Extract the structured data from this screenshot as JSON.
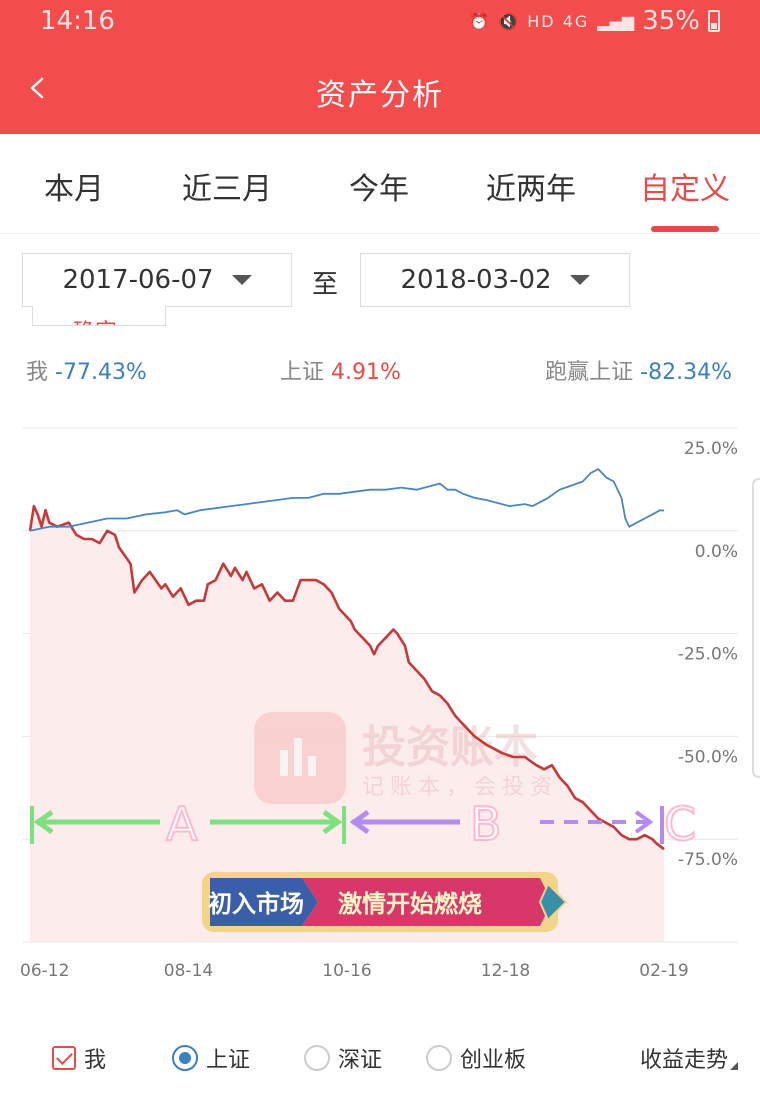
{
  "status_bar": {
    "time": "14:16",
    "icons": "⏰ 🔇 HD 4G",
    "battery": "35%"
  },
  "header": {
    "back_icon": "chevron-left-icon",
    "title": "资产分析"
  },
  "tabs": [
    {
      "label": "本月",
      "active": false
    },
    {
      "label": "近三月",
      "active": false
    },
    {
      "label": "今年",
      "active": false
    },
    {
      "label": "近两年",
      "active": false
    },
    {
      "label": "自定义",
      "active": true
    }
  ],
  "date_range": {
    "start": "2017-06-07",
    "separator": "至",
    "end": "2018-03-02",
    "confirm_label": "确定"
  },
  "summary": {
    "me_label": "我",
    "me_value": "-77.43%",
    "sh_label": "上证",
    "sh_value": "4.91%",
    "beat_label": "跑赢上证",
    "beat_value": "-82.34%"
  },
  "watermark": {
    "name": "投资账本",
    "slogan": "记账本，会投资"
  },
  "promo_banner": {
    "left": "初入市场",
    "right": "激情开始燃烧"
  },
  "annotations": [
    {
      "label": "A",
      "color": "#7ee07e"
    },
    {
      "label": "B",
      "color": "#b48cf0"
    },
    {
      "label": "C",
      "color": "#b48cf0"
    }
  ],
  "legend": [
    {
      "label": "我",
      "type": "checkbox",
      "checked": true
    },
    {
      "label": "上证",
      "type": "radio",
      "checked": true
    },
    {
      "label": "深证",
      "type": "radio",
      "checked": false
    },
    {
      "label": "创业板",
      "type": "radio",
      "checked": false
    }
  ],
  "trend_label": "收益走势",
  "colors": {
    "brand": "#f24c4c",
    "me_line": "#c43a3a",
    "index_line": "#4a86c0",
    "negative_text": "#3b7fc4",
    "positive_text": "#e84a4a"
  },
  "chart_data": {
    "type": "line",
    "x_tick_labels": [
      "06-12",
      "08-14",
      "10-16",
      "12-18",
      "02-19"
    ],
    "x_ticks_index": [
      0,
      41,
      82,
      123,
      164
    ],
    "y_tick_labels": [
      "25.0%",
      "0.0%",
      "-25.0%",
      "-50.0%",
      "-75.0%"
    ],
    "y_ticks": [
      25,
      0,
      -25,
      -50,
      -75
    ],
    "ylim": [
      -100,
      25
    ],
    "grid": true,
    "series": [
      {
        "name": "我",
        "color": "#c43a3a",
        "fill": true,
        "points": [
          [
            0,
            0
          ],
          [
            1,
            6
          ],
          [
            2,
            4
          ],
          [
            3,
            1
          ],
          [
            4,
            5
          ],
          [
            5,
            2
          ],
          [
            7,
            1
          ],
          [
            10,
            2
          ],
          [
            12,
            -1
          ],
          [
            14,
            -2
          ],
          [
            16,
            -2
          ],
          [
            18,
            -3
          ],
          [
            20,
            0
          ],
          [
            22,
            -1
          ],
          [
            23,
            -4
          ],
          [
            26,
            -8
          ],
          [
            27,
            -15
          ],
          [
            29,
            -12
          ],
          [
            31,
            -10
          ],
          [
            34,
            -14
          ],
          [
            35,
            -13
          ],
          [
            37,
            -16
          ],
          [
            39,
            -14
          ],
          [
            41,
            -18
          ],
          [
            43,
            -17
          ],
          [
            45,
            -17
          ],
          [
            46,
            -13
          ],
          [
            48,
            -12
          ],
          [
            50,
            -8
          ],
          [
            52,
            -11
          ],
          [
            53,
            -9
          ],
          [
            55,
            -12
          ],
          [
            56,
            -10
          ],
          [
            58,
            -14
          ],
          [
            60,
            -13
          ],
          [
            62,
            -17
          ],
          [
            64,
            -15
          ],
          [
            66,
            -17
          ],
          [
            68,
            -17
          ],
          [
            70,
            -12
          ],
          [
            71,
            -12
          ],
          [
            74,
            -12
          ],
          [
            76,
            -13
          ],
          [
            78,
            -15
          ],
          [
            80,
            -19
          ],
          [
            81,
            -20
          ],
          [
            83,
            -22
          ],
          [
            84,
            -24
          ],
          [
            86,
            -26
          ],
          [
            88,
            -28
          ],
          [
            89,
            -30
          ],
          [
            90,
            -28
          ],
          [
            92,
            -26
          ],
          [
            94,
            -24
          ],
          [
            95,
            -25
          ],
          [
            97,
            -28
          ],
          [
            98,
            -32
          ],
          [
            100,
            -34
          ],
          [
            102,
            -36
          ],
          [
            104,
            -39
          ],
          [
            106,
            -40
          ],
          [
            108,
            -42
          ],
          [
            110,
            -45
          ],
          [
            111,
            -46
          ],
          [
            113,
            -48
          ],
          [
            115,
            -50
          ],
          [
            118,
            -52
          ],
          [
            120,
            -53
          ],
          [
            122,
            -54
          ],
          [
            125,
            -55
          ],
          [
            128,
            -55
          ],
          [
            131,
            -57
          ],
          [
            133,
            -58
          ],
          [
            135,
            -57
          ],
          [
            137,
            -60
          ],
          [
            139,
            -62
          ],
          [
            141,
            -65
          ],
          [
            143,
            -66
          ],
          [
            145,
            -68
          ],
          [
            147,
            -70
          ],
          [
            149,
            -71
          ],
          [
            151,
            -72
          ],
          [
            153,
            -74
          ],
          [
            155,
            -75
          ],
          [
            157,
            -75
          ],
          [
            159,
            -74
          ],
          [
            161,
            -75
          ],
          [
            162,
            -76
          ],
          [
            164,
            -77.43
          ]
        ]
      },
      {
        "name": "上证",
        "color": "#4a86c0",
        "fill": false,
        "points": [
          [
            0,
            0
          ],
          [
            5,
            1
          ],
          [
            10,
            1
          ],
          [
            15,
            2
          ],
          [
            20,
            3
          ],
          [
            25,
            3
          ],
          [
            30,
            4
          ],
          [
            35,
            4.5
          ],
          [
            38,
            5
          ],
          [
            40,
            4
          ],
          [
            44,
            5
          ],
          [
            48,
            5.5
          ],
          [
            52,
            6
          ],
          [
            56,
            6.5
          ],
          [
            60,
            7
          ],
          [
            64,
            7.5
          ],
          [
            68,
            8
          ],
          [
            72,
            8
          ],
          [
            76,
            9
          ],
          [
            80,
            9
          ],
          [
            84,
            9.5
          ],
          [
            88,
            10
          ],
          [
            92,
            10
          ],
          [
            96,
            10.5
          ],
          [
            100,
            10
          ],
          [
            104,
            11
          ],
          [
            106,
            11.5
          ],
          [
            108,
            10
          ],
          [
            110,
            10
          ],
          [
            112,
            9
          ],
          [
            115,
            8
          ],
          [
            118,
            7.5
          ],
          [
            120,
            7
          ],
          [
            124,
            6
          ],
          [
            128,
            6.5
          ],
          [
            130,
            6
          ],
          [
            134,
            8
          ],
          [
            137,
            10
          ],
          [
            140,
            11
          ],
          [
            143,
            12
          ],
          [
            145,
            14
          ],
          [
            147,
            15
          ],
          [
            149,
            13
          ],
          [
            151,
            12
          ],
          [
            153,
            8
          ],
          [
            154,
            3
          ],
          [
            155,
            1
          ],
          [
            157,
            2
          ],
          [
            159,
            3
          ],
          [
            161,
            4
          ],
          [
            163,
            5
          ],
          [
            164,
            4.91
          ]
        ]
      }
    ]
  }
}
